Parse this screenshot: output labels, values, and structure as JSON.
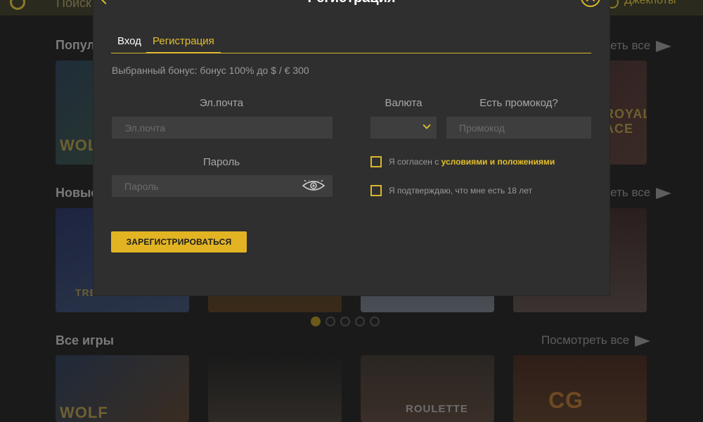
{
  "background": {
    "search_text": "Поиск",
    "jackpots_label": "Джекпоты",
    "sections": [
      {
        "title": "Популярные",
        "see_all": "Посмотреть все"
      },
      {
        "title": "Новые",
        "see_all": "Посмотреть все"
      },
      {
        "title": "Все игры",
        "see_all": "Посмотреть все"
      }
    ],
    "tile_labels": [
      "WOLF GOLD",
      "",
      "",
      "ROYAL ACE",
      "TREASURE WILD",
      "",
      "",
      "",
      "WOLF",
      "",
      "ROULETTE",
      "CG"
    ]
  },
  "modal": {
    "title": "Регистрация",
    "tabs": [
      {
        "label": "Вход",
        "active": false
      },
      {
        "label": "Регистрация",
        "active": true
      }
    ],
    "bonus_text": "Выбранный бонус: бонус 100% до $ / € 300",
    "email": {
      "label": "Эл.почта",
      "placeholder": "Эл.почта"
    },
    "password": {
      "label": "Пароль",
      "placeholder": "Пароль"
    },
    "currency": {
      "label": "Валюта",
      "value": ""
    },
    "promo": {
      "label": "Есть промокод?",
      "placeholder": "Промокод"
    },
    "terms": {
      "prefix": "Я согласен с",
      "link": "условиями и положениями",
      "checked": false
    },
    "age": {
      "text": "Я подтверждаю, что мне есть 18 лет",
      "checked": false
    },
    "submit_label": "ЗАРЕГИСТРИРОВАТЬСЯ"
  },
  "colors": {
    "accent": "#e2b424",
    "modal_bg": "#2f2f2f",
    "input_bg": "#3e3e3e"
  }
}
